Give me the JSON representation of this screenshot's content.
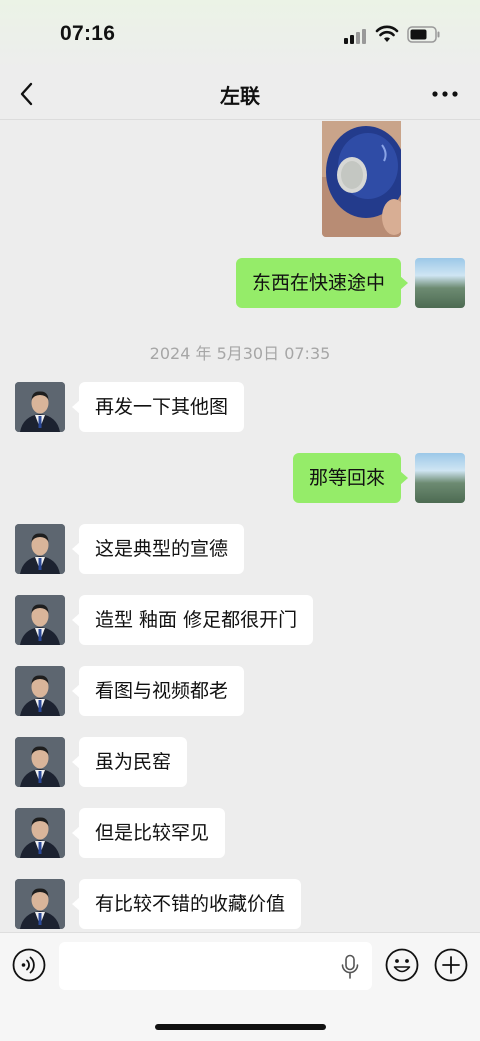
{
  "status_bar": {
    "time": "07:16"
  },
  "header": {
    "title": "左联"
  },
  "chat": {
    "timestamp": "2024 年 5月30日 07:35",
    "messages": [
      {
        "from": "self",
        "text": "东西在快速途中"
      },
      {
        "from": "other",
        "text": "再发一下其他图"
      },
      {
        "from": "self",
        "text": "那等回來"
      },
      {
        "from": "other",
        "text": "这是典型的宣德"
      },
      {
        "from": "other",
        "text": "造型  釉面 修足都很开门"
      },
      {
        "from": "other",
        "text": "看图与视频都老"
      },
      {
        "from": "other",
        "text": "虽为民窑"
      },
      {
        "from": "other",
        "text": "但是比较罕见"
      },
      {
        "from": "other",
        "text": "有比较不错的收藏价值"
      }
    ]
  },
  "input_bar": {
    "value": "",
    "placeholder": ""
  },
  "colors": {
    "self_bubble": "#95ec69",
    "other_bubble": "#ffffff",
    "background": "#ededed"
  },
  "icons": [
    "back-icon",
    "more-icon",
    "voice-icon",
    "mic-icon",
    "emoji-icon",
    "plus-icon"
  ]
}
